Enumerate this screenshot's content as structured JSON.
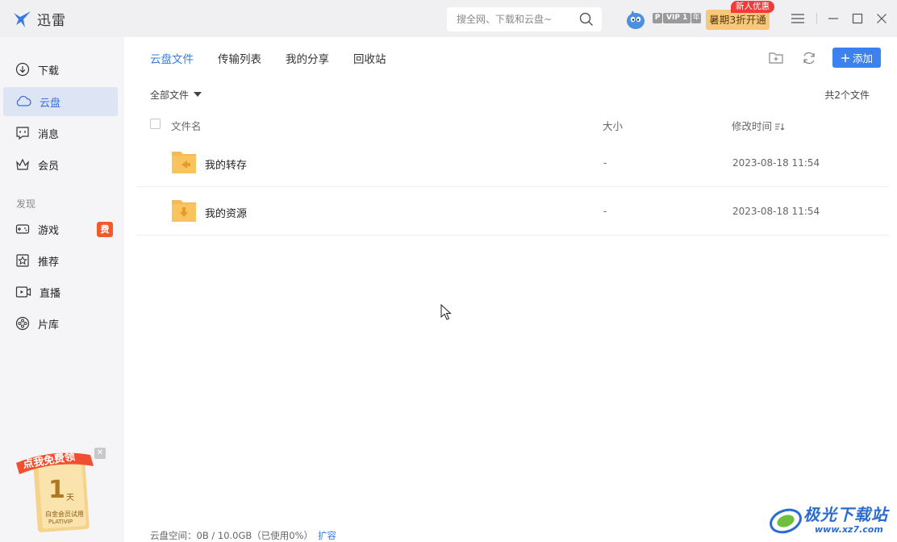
{
  "app": {
    "name": "迅雷",
    "icon": "thunder-bird-icon",
    "accent_color": "#3b82f0"
  },
  "titlebar": {
    "search_placeholder": "搜全网、下载和云盘~",
    "vip_p": "P",
    "vip_label": "VIP 1",
    "vip_year": "年",
    "promo_label": "暑期3折开通",
    "promo_tag": "新人优惠"
  },
  "sidebar": {
    "items": [
      {
        "label": "下载",
        "icon": "download-icon"
      },
      {
        "label": "云盘",
        "icon": "cloud-icon",
        "active": true
      },
      {
        "label": "消息",
        "icon": "message-icon"
      },
      {
        "label": "会员",
        "icon": "crown-icon"
      }
    ],
    "section_label": "发现",
    "discover_items": [
      {
        "label": "游戏",
        "icon": "gamepad-icon",
        "badge": "费"
      },
      {
        "label": "推荐",
        "icon": "star-icon"
      },
      {
        "label": "直播",
        "icon": "live-icon"
      },
      {
        "label": "片库",
        "icon": "film-reel-icon"
      }
    ],
    "promo": {
      "ribbon": "点我免费领",
      "days": "1",
      "days_unit": "天",
      "line1": "白金会员试用",
      "line2": "PLATIVIP"
    }
  },
  "main": {
    "tabs": [
      {
        "label": "云盘文件",
        "active": true
      },
      {
        "label": "传输列表"
      },
      {
        "label": "我的分享"
      },
      {
        "label": "回收站"
      }
    ],
    "add_button": "添加",
    "filter_label": "全部文件",
    "file_count": "共2个文件",
    "columns": {
      "name": "文件名",
      "size": "大小",
      "modified": "修改时间"
    },
    "files": [
      {
        "name": "我的转存",
        "size": "-",
        "modified": "2023-08-18 11:54",
        "icon": "folder-transfer-icon"
      },
      {
        "name": "我的资源",
        "size": "-",
        "modified": "2023-08-18 11:54",
        "icon": "folder-download-icon"
      }
    ],
    "footer": {
      "storage": "云盘空间：0B / 10.0GB（已使用0%）",
      "expand_link": "扩容"
    }
  },
  "watermark": {
    "text": "极光下载站",
    "url": "www.xz7.com"
  }
}
